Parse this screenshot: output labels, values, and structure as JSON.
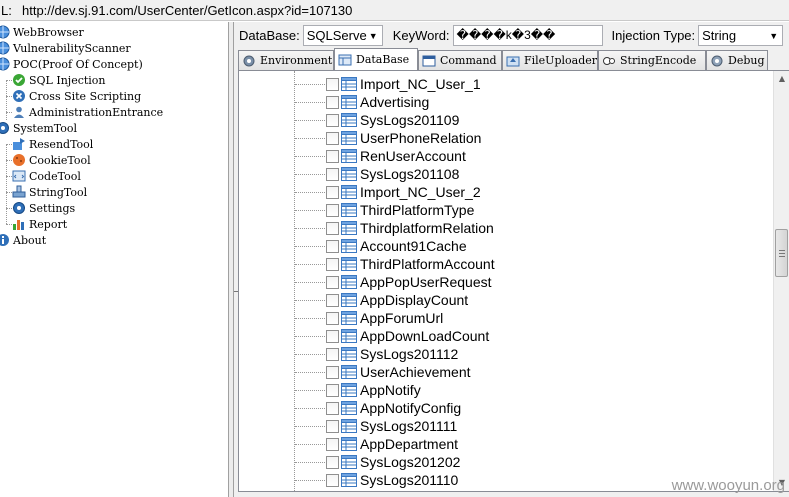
{
  "urlbar": {
    "prefix": "L:",
    "url": "http://dev.sj.91.com/UserCenter/GetIcon.aspx?id=107130"
  },
  "left_tree": {
    "items": [
      {
        "label": "WebBrowser",
        "icon": "globe-icon"
      },
      {
        "label": "VulnerabilityScanner",
        "icon": "globe-icon"
      },
      {
        "label": "POC(Proof Of Concept)",
        "icon": "globe-icon"
      },
      {
        "label": "SQL Injection",
        "icon": "check-icon"
      },
      {
        "label": "Cross Site Scripting",
        "icon": "cross-circle-icon"
      },
      {
        "label": "AdministrationEntrance",
        "icon": "user-icon"
      },
      {
        "label": "SystemTool",
        "icon": "gear-icon"
      },
      {
        "label": "ResendTool",
        "icon": "resend-icon"
      },
      {
        "label": "CookieTool",
        "icon": "cookie-icon"
      },
      {
        "label": "CodeTool",
        "icon": "code-icon"
      },
      {
        "label": "StringTool",
        "icon": "string-icon"
      },
      {
        "label": "Settings",
        "icon": "gear-icon"
      },
      {
        "label": "Report",
        "icon": "chart-icon"
      },
      {
        "label": "About",
        "icon": "info-icon"
      }
    ]
  },
  "toolbar": {
    "database_label": "DataBase:",
    "database_value": "SQLServe",
    "keyword_label": "KeyWord:",
    "keyword_value": "����k�3��",
    "injection_label": "Injection Type:",
    "injection_value": "String"
  },
  "tabs": [
    {
      "label": "Environment",
      "icon": "gear-icon",
      "active": false
    },
    {
      "label": "DataBase",
      "icon": "database-icon",
      "active": true
    },
    {
      "label": "Command",
      "icon": "window-icon",
      "active": false
    },
    {
      "label": "FileUploader",
      "icon": "upload-icon",
      "active": false
    },
    {
      "label": "StringEncode",
      "icon": "encode-icon",
      "active": false
    },
    {
      "label": "Debug",
      "icon": "gear-icon",
      "active": false
    }
  ],
  "tables": [
    "Import_NC_User_1",
    "Advertising",
    "SysLogs201109",
    "UserPhoneRelation",
    "RenUserAccount",
    "SysLogs201108",
    "Import_NC_User_2",
    "ThirdPlatformType",
    "ThirdplatformRelation",
    "Account91Cache",
    "ThirdPlatformAccount",
    "AppPopUserRequest",
    "AppDisplayCount",
    "AppForumUrl",
    "AppDownLoadCount",
    "SysLogs201112",
    "UserAchievement",
    "AppNotify",
    "AppNotifyConfig",
    "SysLogs201111",
    "AppDepartment",
    "SysLogs201202",
    "SysLogs201110"
  ],
  "watermark": "www.wooyun.org",
  "colors": {
    "accent_blue": "#1e6cc8",
    "check_green": "#3aa635",
    "cookie_orange": "#e8702a"
  }
}
